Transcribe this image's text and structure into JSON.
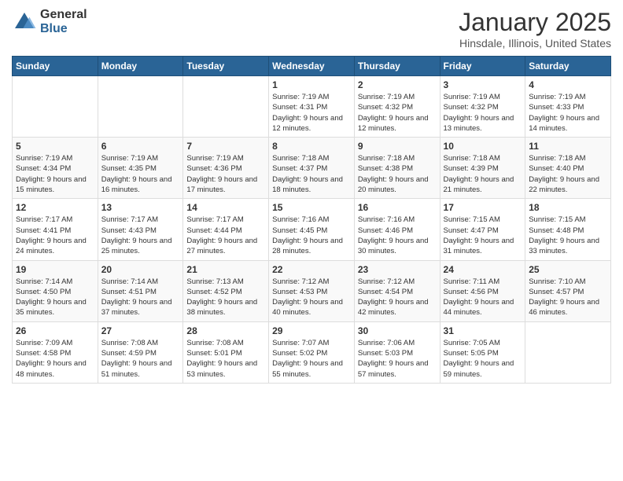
{
  "header": {
    "logo_general": "General",
    "logo_blue": "Blue",
    "month_title": "January 2025",
    "location": "Hinsdale, Illinois, United States"
  },
  "days_of_week": [
    "Sunday",
    "Monday",
    "Tuesday",
    "Wednesday",
    "Thursday",
    "Friday",
    "Saturday"
  ],
  "weeks": [
    [
      {
        "day": "",
        "detail": ""
      },
      {
        "day": "",
        "detail": ""
      },
      {
        "day": "",
        "detail": ""
      },
      {
        "day": "1",
        "detail": "Sunrise: 7:19 AM\nSunset: 4:31 PM\nDaylight: 9 hours\nand 12 minutes."
      },
      {
        "day": "2",
        "detail": "Sunrise: 7:19 AM\nSunset: 4:32 PM\nDaylight: 9 hours\nand 12 minutes."
      },
      {
        "day": "3",
        "detail": "Sunrise: 7:19 AM\nSunset: 4:32 PM\nDaylight: 9 hours\nand 13 minutes."
      },
      {
        "day": "4",
        "detail": "Sunrise: 7:19 AM\nSunset: 4:33 PM\nDaylight: 9 hours\nand 14 minutes."
      }
    ],
    [
      {
        "day": "5",
        "detail": "Sunrise: 7:19 AM\nSunset: 4:34 PM\nDaylight: 9 hours\nand 15 minutes."
      },
      {
        "day": "6",
        "detail": "Sunrise: 7:19 AM\nSunset: 4:35 PM\nDaylight: 9 hours\nand 16 minutes."
      },
      {
        "day": "7",
        "detail": "Sunrise: 7:19 AM\nSunset: 4:36 PM\nDaylight: 9 hours\nand 17 minutes."
      },
      {
        "day": "8",
        "detail": "Sunrise: 7:18 AM\nSunset: 4:37 PM\nDaylight: 9 hours\nand 18 minutes."
      },
      {
        "day": "9",
        "detail": "Sunrise: 7:18 AM\nSunset: 4:38 PM\nDaylight: 9 hours\nand 20 minutes."
      },
      {
        "day": "10",
        "detail": "Sunrise: 7:18 AM\nSunset: 4:39 PM\nDaylight: 9 hours\nand 21 minutes."
      },
      {
        "day": "11",
        "detail": "Sunrise: 7:18 AM\nSunset: 4:40 PM\nDaylight: 9 hours\nand 22 minutes."
      }
    ],
    [
      {
        "day": "12",
        "detail": "Sunrise: 7:17 AM\nSunset: 4:41 PM\nDaylight: 9 hours\nand 24 minutes."
      },
      {
        "day": "13",
        "detail": "Sunrise: 7:17 AM\nSunset: 4:43 PM\nDaylight: 9 hours\nand 25 minutes."
      },
      {
        "day": "14",
        "detail": "Sunrise: 7:17 AM\nSunset: 4:44 PM\nDaylight: 9 hours\nand 27 minutes."
      },
      {
        "day": "15",
        "detail": "Sunrise: 7:16 AM\nSunset: 4:45 PM\nDaylight: 9 hours\nand 28 minutes."
      },
      {
        "day": "16",
        "detail": "Sunrise: 7:16 AM\nSunset: 4:46 PM\nDaylight: 9 hours\nand 30 minutes."
      },
      {
        "day": "17",
        "detail": "Sunrise: 7:15 AM\nSunset: 4:47 PM\nDaylight: 9 hours\nand 31 minutes."
      },
      {
        "day": "18",
        "detail": "Sunrise: 7:15 AM\nSunset: 4:48 PM\nDaylight: 9 hours\nand 33 minutes."
      }
    ],
    [
      {
        "day": "19",
        "detail": "Sunrise: 7:14 AM\nSunset: 4:50 PM\nDaylight: 9 hours\nand 35 minutes."
      },
      {
        "day": "20",
        "detail": "Sunrise: 7:14 AM\nSunset: 4:51 PM\nDaylight: 9 hours\nand 37 minutes."
      },
      {
        "day": "21",
        "detail": "Sunrise: 7:13 AM\nSunset: 4:52 PM\nDaylight: 9 hours\nand 38 minutes."
      },
      {
        "day": "22",
        "detail": "Sunrise: 7:12 AM\nSunset: 4:53 PM\nDaylight: 9 hours\nand 40 minutes."
      },
      {
        "day": "23",
        "detail": "Sunrise: 7:12 AM\nSunset: 4:54 PM\nDaylight: 9 hours\nand 42 minutes."
      },
      {
        "day": "24",
        "detail": "Sunrise: 7:11 AM\nSunset: 4:56 PM\nDaylight: 9 hours\nand 44 minutes."
      },
      {
        "day": "25",
        "detail": "Sunrise: 7:10 AM\nSunset: 4:57 PM\nDaylight: 9 hours\nand 46 minutes."
      }
    ],
    [
      {
        "day": "26",
        "detail": "Sunrise: 7:09 AM\nSunset: 4:58 PM\nDaylight: 9 hours\nand 48 minutes."
      },
      {
        "day": "27",
        "detail": "Sunrise: 7:08 AM\nSunset: 4:59 PM\nDaylight: 9 hours\nand 51 minutes."
      },
      {
        "day": "28",
        "detail": "Sunrise: 7:08 AM\nSunset: 5:01 PM\nDaylight: 9 hours\nand 53 minutes."
      },
      {
        "day": "29",
        "detail": "Sunrise: 7:07 AM\nSunset: 5:02 PM\nDaylight: 9 hours\nand 55 minutes."
      },
      {
        "day": "30",
        "detail": "Sunrise: 7:06 AM\nSunset: 5:03 PM\nDaylight: 9 hours\nand 57 minutes."
      },
      {
        "day": "31",
        "detail": "Sunrise: 7:05 AM\nSunset: 5:05 PM\nDaylight: 9 hours\nand 59 minutes."
      },
      {
        "day": "",
        "detail": ""
      }
    ]
  ]
}
